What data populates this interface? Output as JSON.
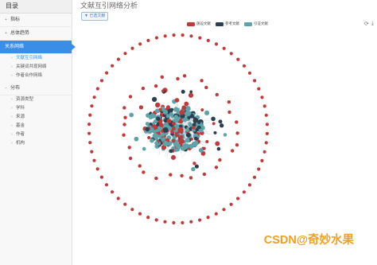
{
  "sidebar": {
    "title": "目录",
    "items": [
      {
        "label": "指标",
        "toggle": "+"
      },
      {
        "label": "总体趋势",
        "toggle": "+"
      },
      {
        "label": "关系网络",
        "toggle": ""
      },
      {
        "label": "文献互引网络"
      },
      {
        "label": "关键词共现网络"
      },
      {
        "label": "作者合作网络"
      },
      {
        "label": "分布",
        "toggle": "−"
      },
      {
        "label": "资源类型"
      },
      {
        "label": "学科"
      },
      {
        "label": "来源"
      },
      {
        "label": "基金"
      },
      {
        "label": "作者"
      },
      {
        "label": "机构"
      }
    ]
  },
  "page": {
    "title": "文献互引网络分析",
    "button": "已选文献"
  },
  "legend": [
    {
      "label": "施设文献",
      "color": "#c0393b"
    },
    {
      "label": "参考文献",
      "color": "#2c3e50"
    },
    {
      "label": "引证文献",
      "color": "#5da3a8"
    }
  ],
  "tools": {
    "refresh": "⟳",
    "save": "⤓"
  },
  "watermark": "CSDN@奇妙水果"
}
